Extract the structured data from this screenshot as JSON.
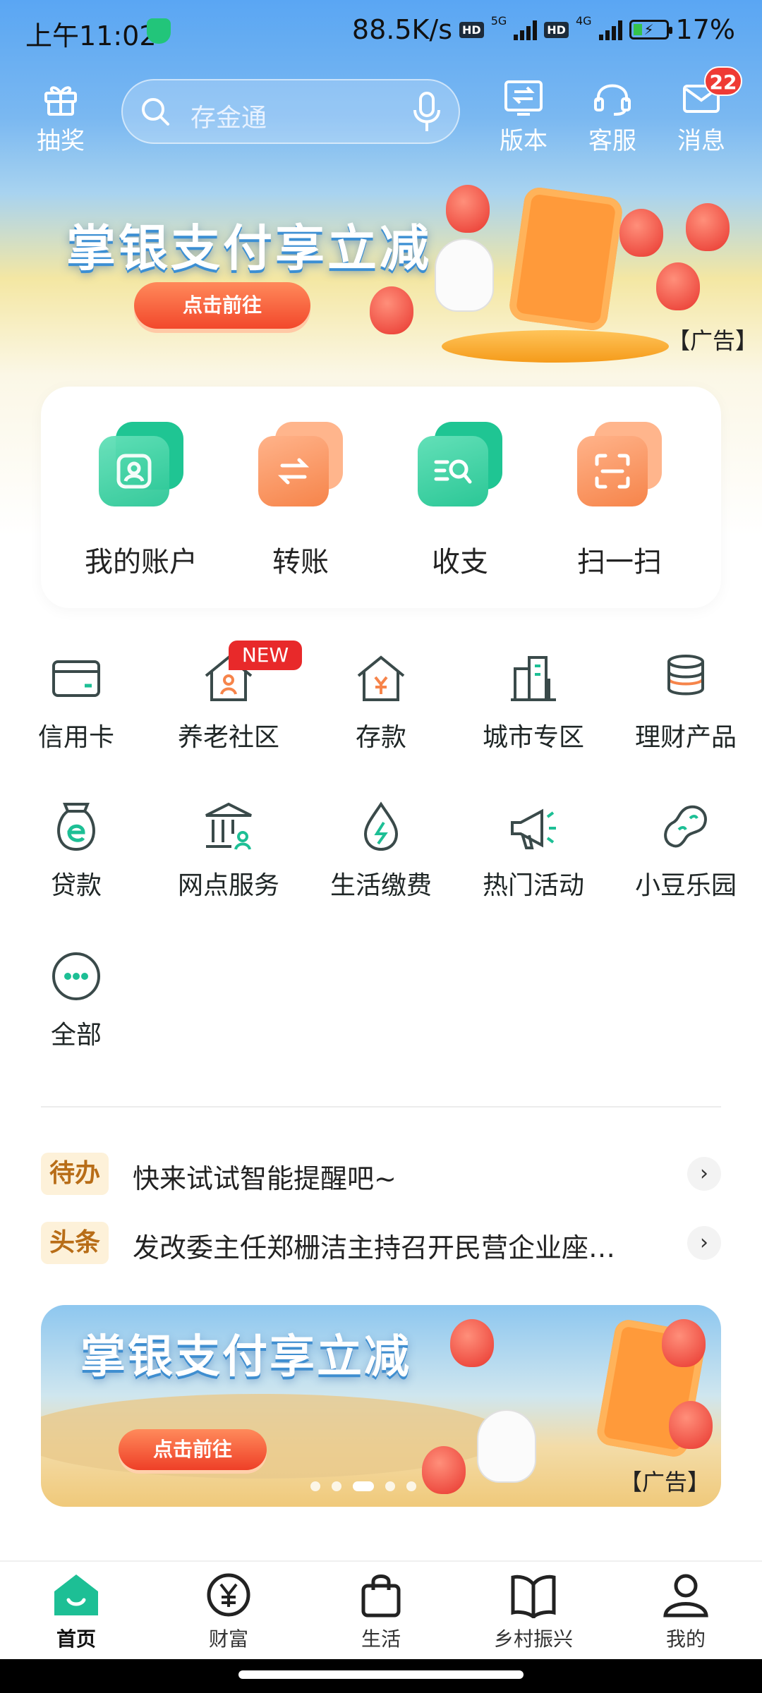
{
  "status_bar": {
    "time": "上午11:02",
    "speed": "88.5K/s",
    "hd1": "HD",
    "hd2": "HD",
    "net5g": "5G",
    "net4g": "4G",
    "battery": "17%"
  },
  "header": {
    "lottery": "抽奖",
    "search_placeholder": "存金通",
    "version": "版本",
    "service": "客服",
    "messages": "消息",
    "message_count": "22"
  },
  "banner_top": {
    "title": "掌银支付享立减",
    "cta": "点击前往",
    "ad_tag": "【广告】"
  },
  "quick_actions": [
    {
      "label": "我的账户",
      "icon": "account-icon"
    },
    {
      "label": "转账",
      "icon": "transfer-icon"
    },
    {
      "label": "收支",
      "icon": "income-expense-icon"
    },
    {
      "label": "扫一扫",
      "icon": "scan-icon"
    }
  ],
  "services": [
    {
      "label": "信用卡",
      "icon": "credit-card-icon"
    },
    {
      "label": "养老社区",
      "icon": "elderly-community-icon",
      "badge": "NEW"
    },
    {
      "label": "存款",
      "icon": "deposit-icon"
    },
    {
      "label": "城市专区",
      "icon": "city-zone-icon"
    },
    {
      "label": "理财产品",
      "icon": "wealth-product-icon"
    },
    {
      "label": "贷款",
      "icon": "loan-icon"
    },
    {
      "label": "网点服务",
      "icon": "branch-service-icon"
    },
    {
      "label": "生活缴费",
      "icon": "utility-payment-icon"
    },
    {
      "label": "热门活动",
      "icon": "hot-activity-icon"
    },
    {
      "label": "小豆乐园",
      "icon": "xiaodou-park-icon"
    },
    {
      "label": "全部",
      "icon": "more-icon"
    }
  ],
  "notices": [
    {
      "tag": "待办",
      "text": "快来试试智能提醒吧~"
    },
    {
      "tag": "头条",
      "text": "发改委主任郑栅洁主持召开民营企业座…"
    }
  ],
  "banner_bottom": {
    "title": "掌银支付享立减",
    "cta": "点击前往",
    "ad_tag": "【广告】",
    "slide_count": 5,
    "active_slide": 3
  },
  "bottom_nav": [
    {
      "label": "首页",
      "icon": "home-icon",
      "active": true
    },
    {
      "label": "财富",
      "icon": "wealth-icon"
    },
    {
      "label": "生活",
      "icon": "shopping-bag-icon"
    },
    {
      "label": "乡村振兴",
      "icon": "rural-revitalization-icon"
    },
    {
      "label": "我的",
      "icon": "profile-icon"
    }
  ],
  "colors": {
    "accent": "#1dbf95",
    "badge_red": "#ef3b35",
    "orange": "#f6844a"
  }
}
